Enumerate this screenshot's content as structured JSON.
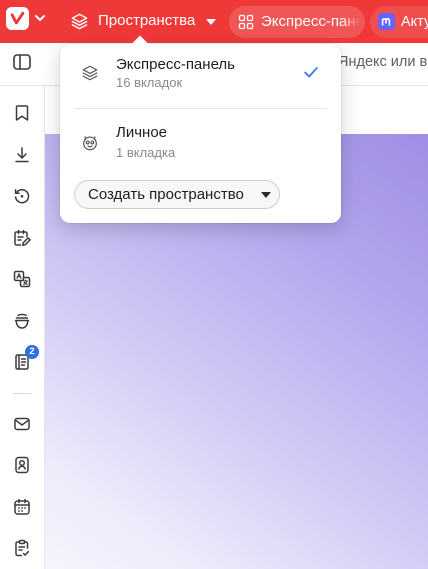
{
  "colors": {
    "titlebar_red": "#EF3939",
    "check_blue": "#2F7BE5",
    "badge_blue": "#2F6FDF",
    "mastodon_purple": "#6364FF"
  },
  "titlebar": {
    "logo_icon": "vivaldi-logo-icon",
    "menu_icon": "chevron-down-icon",
    "spaces": {
      "icon": "layers-icon",
      "label": "Пространства",
      "caret_icon": "caret-down-icon"
    },
    "tabs": [
      {
        "icon": "grid-icon",
        "label": "Экспресс-пане",
        "active": true
      },
      {
        "icon": "mastodon-icon",
        "label": "Акту",
        "active": false
      }
    ]
  },
  "toolbar": {
    "panel_toggle_icon": "sidebar-toggle-icon",
    "address_placeholder": "Яндекс или в"
  },
  "sidebar": {
    "items": [
      {
        "icon": "bookmark-icon"
      },
      {
        "icon": "download-icon"
      },
      {
        "icon": "history-icon"
      },
      {
        "icon": "notes-icon"
      },
      {
        "icon": "translate-icon"
      },
      {
        "icon": "window-panel-icon"
      },
      {
        "icon": "reading-list-icon",
        "badge": "2"
      },
      {
        "icon": "mail-icon"
      },
      {
        "icon": "contacts-icon"
      },
      {
        "icon": "calendar-icon"
      },
      {
        "icon": "tasks-icon"
      }
    ]
  },
  "spaces_menu": {
    "items": [
      {
        "icon": "layers-icon",
        "title": "Экспресс-панель",
        "subtitle": "16 вкладок",
        "selected": true,
        "check_icon": "checkmark-icon"
      },
      {
        "icon": "face-icon",
        "title": "Личное",
        "subtitle": "1 вкладка",
        "selected": false
      }
    ],
    "create_button": {
      "label": "Создать пространство",
      "caret_icon": "caret-down-icon"
    }
  }
}
